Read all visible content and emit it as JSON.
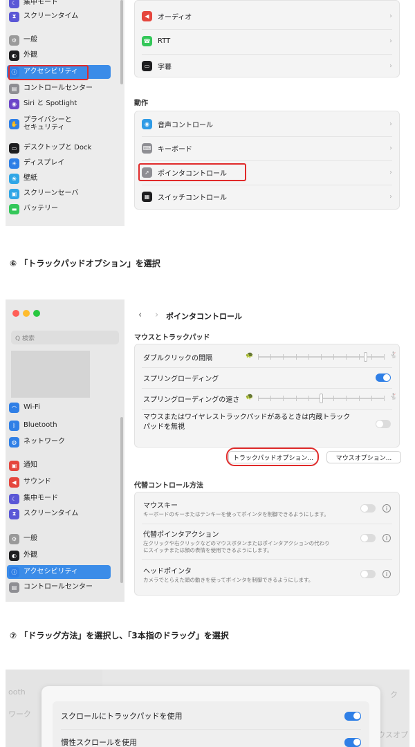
{
  "panel1": {
    "sidebar": [
      {
        "label": "集中モード",
        "color": "#5a57d6",
        "glyph": "☾"
      },
      {
        "label": "スクリーンタイム",
        "color": "#5a57d6",
        "glyph": "⧗"
      },
      {
        "label": "一般",
        "color": "#9a9a9a",
        "glyph": "⚙"
      },
      {
        "label": "外観",
        "color": "#1d1d1f",
        "glyph": "◐"
      },
      {
        "label": "アクセシビリティ",
        "color": "#2f7fe6",
        "glyph": "ⓘ",
        "selected": true
      },
      {
        "label": "コントロールセンター",
        "color": "#8e8e93",
        "glyph": "▤"
      },
      {
        "label": "Siri と Spotlight",
        "color": "#6b45c8",
        "glyph": "◉"
      },
      {
        "label": "プライバシーと\nセキュリティ",
        "color": "#2f7fe6",
        "glyph": "✋"
      },
      {
        "label": "デスクトップと Dock",
        "color": "#1d1d1f",
        "glyph": "▭"
      },
      {
        "label": "ディスプレイ",
        "color": "#2f7fe6",
        "glyph": "☀"
      },
      {
        "label": "壁紙",
        "color": "#30a6e6",
        "glyph": "❀"
      },
      {
        "label": "スクリーンセーバ",
        "color": "#30a6e6",
        "glyph": "▣"
      },
      {
        "label": "バッテリー",
        "color": "#34c759",
        "glyph": "▬"
      }
    ],
    "top_rows": [
      {
        "label": "オーディオ",
        "color": "#e5463d",
        "glyph": "◀"
      },
      {
        "label": "RTT",
        "color": "#34c759",
        "glyph": "☎"
      },
      {
        "label": "字幕",
        "color": "#1d1d1f",
        "glyph": "▭"
      }
    ],
    "section_title": "動作",
    "action_rows": [
      {
        "label": "音声コントロール",
        "color": "#2f9be6",
        "glyph": "◉"
      },
      {
        "label": "キーボード",
        "color": "#8e8e93",
        "glyph": "⌨"
      },
      {
        "label": "ポインタコントロール",
        "color": "#8e8e93",
        "glyph": "➚"
      },
      {
        "label": "スイッチコントロール",
        "color": "#1d1d1f",
        "glyph": "▦"
      }
    ],
    "chevron": "›"
  },
  "step6": "⑥ 「トラックパッドオプション」を選択",
  "panel2": {
    "search_placeholder": "Q 検索",
    "back": "‹",
    "forward": "›",
    "title": "ポインタコントロール",
    "sidebar": [
      {
        "label": "Wi-Fi",
        "color": "#2f7fe6",
        "glyph": "◠"
      },
      {
        "label": "Bluetooth",
        "color": "#2f7fe6",
        "glyph": "ᛒ"
      },
      {
        "label": "ネットワーク",
        "color": "#2f7fe6",
        "glyph": "◍"
      },
      {
        "label": "通知",
        "color": "#e5463d",
        "glyph": "▣"
      },
      {
        "label": "サウンド",
        "color": "#e5463d",
        "glyph": "◀"
      },
      {
        "label": "集中モード",
        "color": "#5a57d6",
        "glyph": "☾"
      },
      {
        "label": "スクリーンタイム",
        "color": "#5a57d6",
        "glyph": "⧗"
      },
      {
        "label": "一般",
        "color": "#9a9a9a",
        "glyph": "⚙"
      },
      {
        "label": "外観",
        "color": "#1d1d1f",
        "glyph": "◐"
      },
      {
        "label": "アクセシビリティ",
        "color": "#2f7fe6",
        "glyph": "ⓘ",
        "selected": true
      },
      {
        "label": "コントロールセンター",
        "color": "#8e8e93",
        "glyph": "▤"
      }
    ],
    "section1": "マウスとトラックパッド",
    "double_click": "ダブルクリックの間隔",
    "double_click_level": 0.85,
    "spring": "スプリングローディング",
    "spring_on": true,
    "spring_speed": "スプリングローディングの速さ",
    "spring_speed_level": 0.5,
    "ignore_builtin": "マウスまたはワイヤレストラックパッドがあるときは内蔵トラック\nパッドを無視",
    "trackpad_options": "トラックパッドオプション...",
    "mouse_options": "マウスオプション...",
    "section2": "代替コントロール方法",
    "mouse_keys": "マウスキー",
    "mouse_keys_desc": "キーボードのキーまたはテンキーを使ってポインタを制御できるようにします。",
    "alt_pointer": "代替ポインタアクション",
    "alt_pointer_desc": "左クリックや右クリックなどのマウスボタンまたはポインタアクションの代わり\nにスイッチまたは顔の表情を使用できるようにします。",
    "head_pointer": "ヘッドポインタ",
    "head_pointer_desc": "カメラでとらえた頭の動きを使ってポインタを制御できるようにします。",
    "info": "i"
  },
  "step7": "⑦ 「ドラッグ方法」を選択し、「3本指のドラッグ」を選択",
  "panel3": {
    "ghost_left1": "ooth",
    "ghost_left2": "ワーク",
    "ghost_right": "ウスオプ",
    "ghost_top": "ク",
    "row1": "スクロールにトラックパッドを使用",
    "row2": "慣性スクロールを使用"
  }
}
